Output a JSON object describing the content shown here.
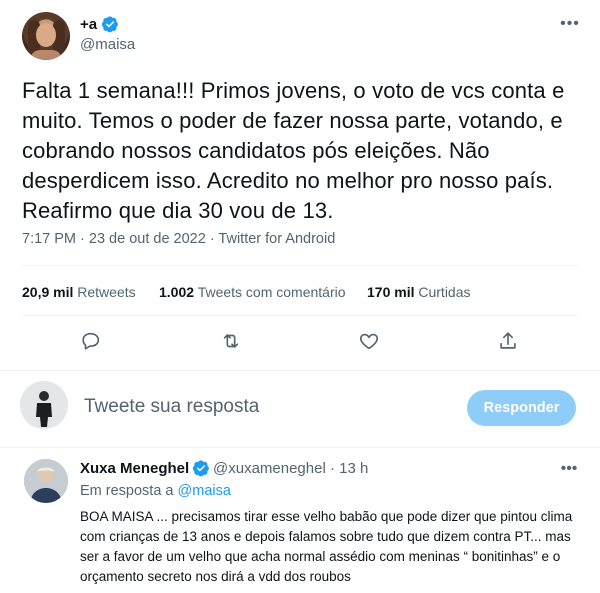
{
  "tweet": {
    "display_name": "+a",
    "handle": "@maisa",
    "text": "Falta 1 semana!!! Primos jovens, o voto de vcs conta e muito. Temos o poder de fazer nossa parte, votando, e cobrando nossos candidatos pós eleições. Não desperdicem isso. Acredito no melhor pro nosso país. Reafirmo que dia 30 vou de 13.",
    "meta": "7:17 PM · 23 de out de 2022 · Twitter for Android",
    "stats": {
      "retweets_count": "20,9 mil",
      "retweets_label": "Retweets",
      "quotes_count": "1.002",
      "quotes_label": "Tweets com comentário",
      "likes_count": "170 mil",
      "likes_label": "Curtidas"
    }
  },
  "compose": {
    "placeholder": "Tweete sua resposta",
    "button_label": "Responder"
  },
  "reply": {
    "display_name": "Xuxa Meneghel",
    "handle_time": "@xuxameneghel · 13 h",
    "replying_prefix": "Em resposta a",
    "replying_handle": "@maisa",
    "text": "BOA MAISA ... precisamos tirar esse velho babão que pode dizer que pintou clima com crianças de 13 anos e depois falamos sobre tudo que dizem contra PT... mas ser a favor de um velho que acha normal assédio com meninas “ bonitinhas” e o orçamento secreto nos dirá a vdd dos roubos"
  },
  "icons": {
    "verified": "verified-badge-icon",
    "more": "more-dots-icon",
    "reply": "reply-bubble-icon",
    "retweet": "retweet-icon",
    "like": "heart-icon",
    "share": "share-icon"
  },
  "colors": {
    "accent": "#1d9bf0",
    "button_disabled": "#8ecdf8",
    "secondary_text": "#536471"
  }
}
